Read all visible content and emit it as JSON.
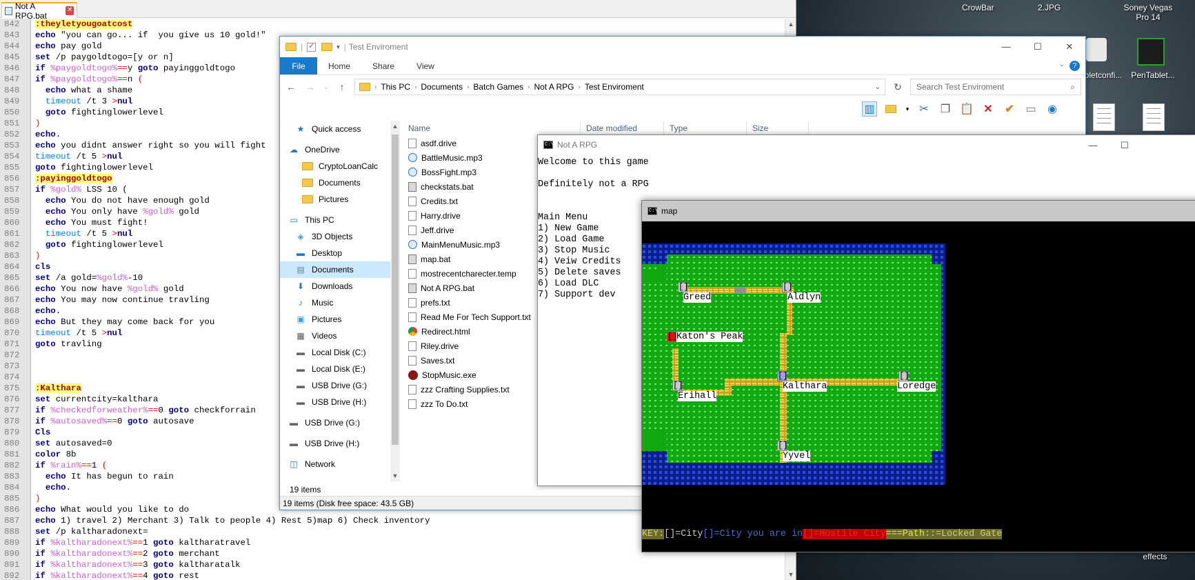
{
  "desktop": {
    "labels": [
      "CrowBar",
      "2.JPG",
      "Soney Vegas Pro 14",
      "abletconfi...",
      "PenTablet...",
      "effects"
    ],
    "colors": {
      "wallpaper": "#2a3640"
    }
  },
  "editor": {
    "tab_title": "Not A RPG.bat",
    "line_numbers": [
      "842",
      "843",
      "844",
      "845",
      "846",
      "847",
      "848",
      "849",
      "850",
      "851",
      "852",
      "853",
      "854",
      "855",
      "856",
      "857",
      "858",
      "859",
      "860",
      "861",
      "862",
      "863",
      "864",
      "865",
      "866",
      "867",
      "868",
      "869",
      "870",
      "871",
      "872",
      "873",
      "874",
      "875",
      "876",
      "877",
      "878",
      "879",
      "880",
      "881",
      "882",
      "883",
      "884",
      "885",
      "886",
      "887",
      "888",
      "889",
      "890",
      "891",
      "892"
    ],
    "lines": [
      [
        [
          "lbl",
          ":theyletyougoatcost"
        ]
      ],
      [
        [
          "kw",
          "echo"
        ],
        [
          "",
          " \"you can go... if  you give us 10 gold!\""
        ]
      ],
      [
        [
          "kw",
          "echo"
        ],
        [
          "",
          " pay gold"
        ]
      ],
      [
        [
          "kw",
          "set"
        ],
        [
          "",
          " /p paygoldtogo=[y or n]"
        ]
      ],
      [
        [
          "kw",
          "if"
        ],
        [
          "",
          " "
        ],
        [
          "var",
          "%paygoldtogo%"
        ],
        [
          "op",
          "=="
        ],
        [
          "",
          "y "
        ],
        [
          "kw",
          "goto"
        ],
        [
          "",
          " payinggoldtogo"
        ]
      ],
      [
        [
          "kw",
          "if"
        ],
        [
          "",
          " "
        ],
        [
          "var",
          "%paygoldtogo%"
        ],
        [
          "op",
          "=="
        ],
        [
          "",
          "n "
        ],
        [
          "op",
          "("
        ]
      ],
      [
        [
          "",
          "  "
        ],
        [
          "kw",
          "echo"
        ],
        [
          "",
          " what a shame"
        ]
      ],
      [
        [
          "",
          "  "
        ],
        [
          "tcmd",
          "timeout"
        ],
        [
          "",
          " /t 3 "
        ],
        [
          "op",
          ">"
        ],
        [
          "kw",
          "nul"
        ]
      ],
      [
        [
          "",
          "  "
        ],
        [
          "kw",
          "goto"
        ],
        [
          "",
          " fightinglowerlevel"
        ]
      ],
      [
        [
          "op",
          ")"
        ]
      ],
      [
        [
          "kw",
          "echo"
        ],
        [
          "",
          "."
        ]
      ],
      [
        [
          "kw",
          "echo"
        ],
        [
          "",
          " you didnt answer right so you will fight"
        ]
      ],
      [
        [
          "tcmd",
          "timeout"
        ],
        [
          "",
          " /t 5 "
        ],
        [
          "op",
          ">"
        ],
        [
          "kw",
          "nul"
        ]
      ],
      [
        [
          "kw",
          "goto"
        ],
        [
          "",
          " fightinglowerlevel"
        ]
      ],
      [
        [
          "lbl",
          ":payinggoldtogo"
        ]
      ],
      [
        [
          "kw",
          "if"
        ],
        [
          "",
          " "
        ],
        [
          "var",
          "%gold%"
        ],
        [
          "",
          " LSS 10 ("
        ]
      ],
      [
        [
          "",
          "  "
        ],
        [
          "kw",
          "echo"
        ],
        [
          "",
          " You do not have enough gold"
        ]
      ],
      [
        [
          "",
          "  "
        ],
        [
          "kw",
          "echo"
        ],
        [
          "",
          " You only have "
        ],
        [
          "var",
          "%gold%"
        ],
        [
          "",
          " gold"
        ]
      ],
      [
        [
          "",
          "  "
        ],
        [
          "kw",
          "echo"
        ],
        [
          "",
          " You must fight!"
        ]
      ],
      [
        [
          "",
          "  "
        ],
        [
          "tcmd",
          "timeout"
        ],
        [
          "",
          " /t 5 "
        ],
        [
          "op",
          ">"
        ],
        [
          "kw",
          "nul"
        ]
      ],
      [
        [
          "",
          "  "
        ],
        [
          "kw",
          "goto"
        ],
        [
          "",
          " fightinglowerlevel"
        ]
      ],
      [
        [
          "op",
          ")"
        ]
      ],
      [
        [
          "kw",
          "cls"
        ]
      ],
      [
        [
          "kw",
          "set"
        ],
        [
          "",
          " /a gold="
        ],
        [
          "var",
          "%gold%"
        ],
        [
          "",
          "-10"
        ]
      ],
      [
        [
          "kw",
          "echo"
        ],
        [
          "",
          " You now have "
        ],
        [
          "var",
          "%gold%"
        ],
        [
          "",
          " gold"
        ]
      ],
      [
        [
          "kw",
          "echo"
        ],
        [
          "",
          " You may now continue travling"
        ]
      ],
      [
        [
          "kw",
          "echo"
        ],
        [
          "",
          "."
        ]
      ],
      [
        [
          "kw",
          "echo"
        ],
        [
          "",
          " But they may come back for you"
        ]
      ],
      [
        [
          "tcmd",
          "timeout"
        ],
        [
          "",
          " /t 5 "
        ],
        [
          "op",
          ">"
        ],
        [
          "kw",
          "nul"
        ]
      ],
      [
        [
          "kw",
          "goto"
        ],
        [
          "",
          " travling"
        ]
      ],
      [],
      [],
      [],
      [
        [
          "lbl",
          ":Kalthara"
        ]
      ],
      [
        [
          "kw",
          "set"
        ],
        [
          "",
          " currentcity=kalthara"
        ]
      ],
      [
        [
          "kw",
          "if"
        ],
        [
          "",
          " "
        ],
        [
          "var",
          "%checkedforweather%"
        ],
        [
          "op",
          "=="
        ],
        [
          "",
          "0 "
        ],
        [
          "kw",
          "goto"
        ],
        [
          "",
          " checkforrain"
        ]
      ],
      [
        [
          "kw",
          "if"
        ],
        [
          "",
          " "
        ],
        [
          "var",
          "%autosaved%"
        ],
        [
          "op",
          "=="
        ],
        [
          "",
          "0 "
        ],
        [
          "kw",
          "goto"
        ],
        [
          "",
          " autosave"
        ]
      ],
      [
        [
          "kw",
          "Cls"
        ]
      ],
      [
        [
          "kw",
          "set"
        ],
        [
          "",
          " autosaved=0"
        ]
      ],
      [
        [
          "kw",
          "color"
        ],
        [
          "",
          " 8b"
        ]
      ],
      [
        [
          "kw",
          "if"
        ],
        [
          "",
          " "
        ],
        [
          "var",
          "%rain%"
        ],
        [
          "op",
          "=="
        ],
        [
          "",
          "1 "
        ],
        [
          "op",
          "("
        ]
      ],
      [
        [
          "",
          "  "
        ],
        [
          "kw",
          "echo"
        ],
        [
          "",
          " It has begun to rain"
        ]
      ],
      [
        [
          "",
          "  "
        ],
        [
          "kw",
          "echo"
        ],
        [
          "",
          "."
        ]
      ],
      [
        [
          "op",
          ")"
        ]
      ],
      [
        [
          "kw",
          "echo"
        ],
        [
          "",
          " What would you like to do"
        ]
      ],
      [
        [
          "kw",
          "echo"
        ],
        [
          "",
          " 1) travel 2) Merchant 3) Talk to people 4) Rest 5)map 6) Check inventory"
        ]
      ],
      [
        [
          "kw",
          "set"
        ],
        [
          "",
          " /p kaltharadonext="
        ]
      ],
      [
        [
          "kw",
          "if"
        ],
        [
          "",
          " "
        ],
        [
          "var",
          "%kaltharadonext%"
        ],
        [
          "op",
          "=="
        ],
        [
          "",
          "1 "
        ],
        [
          "kw",
          "goto"
        ],
        [
          "",
          " kaltharatravel"
        ]
      ],
      [
        [
          "kw",
          "if"
        ],
        [
          "",
          " "
        ],
        [
          "var",
          "%kaltharadonext%"
        ],
        [
          "op",
          "=="
        ],
        [
          "",
          "2 "
        ],
        [
          "kw",
          "goto"
        ],
        [
          "",
          " merchant"
        ]
      ],
      [
        [
          "kw",
          "if"
        ],
        [
          "",
          " "
        ],
        [
          "var",
          "%kaltharadonext%"
        ],
        [
          "op",
          "=="
        ],
        [
          "",
          "3 "
        ],
        [
          "kw",
          "goto"
        ],
        [
          "",
          " kaltharatalk"
        ]
      ],
      [
        [
          "kw",
          "if"
        ],
        [
          "",
          " "
        ],
        [
          "var",
          "%kaltharadonext%"
        ],
        [
          "op",
          "=="
        ],
        [
          "",
          "4 "
        ],
        [
          "kw",
          "goto"
        ],
        [
          "",
          " rest"
        ]
      ]
    ]
  },
  "explorer": {
    "title": "Test Enviroment",
    "ribbon_tabs": [
      "File",
      "Home",
      "Share",
      "View"
    ],
    "breadcrumb": [
      "This PC",
      "Documents",
      "Batch Games",
      "Not A RPG",
      "Test Enviroment"
    ],
    "search_placeholder": "Search Test Enviroment",
    "nav_items": [
      {
        "label": "Quick access",
        "icon": "star-icon",
        "indent": 1
      },
      {
        "label": "OneDrive",
        "icon": "cloud-icon",
        "indent": 0
      },
      {
        "label": "CryptoLoanCalc",
        "icon": "folder-icon",
        "indent": 2
      },
      {
        "label": "Documents",
        "icon": "folder-icon",
        "indent": 2
      },
      {
        "label": "Pictures",
        "icon": "folder-icon",
        "indent": 2
      },
      {
        "label": "This PC",
        "icon": "computer-icon",
        "indent": 0
      },
      {
        "label": "3D Objects",
        "icon": "cube-icon",
        "indent": 1
      },
      {
        "label": "Desktop",
        "icon": "desktop-icon",
        "indent": 1
      },
      {
        "label": "Documents",
        "icon": "documents-icon",
        "indent": 1,
        "selected": true
      },
      {
        "label": "Downloads",
        "icon": "download-icon",
        "indent": 1
      },
      {
        "label": "Music",
        "icon": "music-icon",
        "indent": 1
      },
      {
        "label": "Pictures",
        "icon": "pictures-icon",
        "indent": 1
      },
      {
        "label": "Videos",
        "icon": "videos-icon",
        "indent": 1
      },
      {
        "label": "Local Disk (C:)",
        "icon": "drive-icon",
        "indent": 1
      },
      {
        "label": "Local Disk (E:)",
        "icon": "drive-icon",
        "indent": 1
      },
      {
        "label": "USB Drive (G:)",
        "icon": "drive-icon",
        "indent": 1
      },
      {
        "label": "USB Drive (H:)",
        "icon": "drive-icon",
        "indent": 1
      },
      {
        "label": "USB Drive (G:)",
        "icon": "drive-icon",
        "indent": 0
      },
      {
        "label": "USB Drive (H:)",
        "icon": "drive-icon",
        "indent": 0
      },
      {
        "label": "Network",
        "icon": "network-icon",
        "indent": 0
      }
    ],
    "columns": [
      "Name",
      "Date modified",
      "Type",
      "Size"
    ],
    "files": [
      {
        "name": "asdf.drive",
        "kind": "file"
      },
      {
        "name": "BattleMusic.mp3",
        "kind": "audio"
      },
      {
        "name": "BossFight.mp3",
        "kind": "audio"
      },
      {
        "name": "checkstats.bat",
        "kind": "bat"
      },
      {
        "name": "Credits.txt",
        "kind": "file"
      },
      {
        "name": "Harry.drive",
        "kind": "file"
      },
      {
        "name": "Jeff.drive",
        "kind": "file"
      },
      {
        "name": "MainMenuMusic.mp3",
        "kind": "audio"
      },
      {
        "name": "map.bat",
        "kind": "bat"
      },
      {
        "name": "mostrecentcharecter.temp",
        "kind": "file"
      },
      {
        "name": "Not A RPG.bat",
        "kind": "bat"
      },
      {
        "name": "prefs.txt",
        "kind": "file"
      },
      {
        "name": "Read Me For Tech Support.txt",
        "kind": "file"
      },
      {
        "name": "Redirect.html",
        "kind": "chrome"
      },
      {
        "name": "Riley.drive",
        "kind": "file"
      },
      {
        "name": "Saves.txt",
        "kind": "file"
      },
      {
        "name": "StopMusic.exe",
        "kind": "exe"
      },
      {
        "name": "zzz Crafting Supplies.txt",
        "kind": "file"
      },
      {
        "name": "zzz To Do.txt",
        "kind": "file"
      }
    ],
    "items_count": "19 items",
    "status_bar": "19 items (Disk free space: 43.5 GB)"
  },
  "console": {
    "title": "Not A RPG",
    "text": "Welcome to this game\n\nDefinitely not a RPG\n\n\nMain Menu\n1) New Game\n2) Load Game\n3) Stop Music\n4) Veiw Credits\n5) Delete saves\n6) Load DLC\n7) Support dev"
  },
  "map": {
    "title": "map",
    "cities": [
      {
        "name": "Greed",
        "type": "city"
      },
      {
        "name": "Aldlyn",
        "type": "city"
      },
      {
        "name": "Katon's Peak",
        "type": "hostile"
      },
      {
        "name": "Erihall",
        "type": "city"
      },
      {
        "name": "Kalthara",
        "type": "current"
      },
      {
        "name": "Loredge",
        "type": "city"
      },
      {
        "name": "Yyvel",
        "type": "city"
      }
    ],
    "key": [
      {
        "text": "KEY:",
        "fg": "#cfcf7a",
        "bg": "#6b6b2a"
      },
      {
        "text": "[]",
        "fg": "#c8c8c8",
        "bg": "#000000"
      },
      {
        "text": "=City",
        "fg": "#c8c8c8",
        "bg": "#000000"
      },
      {
        "text": "[]",
        "fg": "#4a6ad6",
        "bg": "#000000"
      },
      {
        "text": "=City you are in",
        "fg": "#4a6ad6",
        "bg": "#000000"
      },
      {
        "text": "[]",
        "fg": "#ff2020",
        "bg": "#c00000"
      },
      {
        "text": "=Hostile City",
        "fg": "#ff2020",
        "bg": "#c00000"
      },
      {
        "text": "==",
        "fg": "#e8e84a",
        "bg": "#6b6b2a"
      },
      {
        "text": "=Path",
        "fg": "#e8e84a",
        "bg": "#6b6b2a"
      },
      {
        "text": "::",
        "fg": "#cfcf7a",
        "bg": "#6b6b2a"
      },
      {
        "text": "=Locked Gate",
        "fg": "#cfcf7a",
        "bg": "#6b6b2a"
      }
    ],
    "colors": {
      "water": "#0a1e8c",
      "water_glyph": "#2c4de0",
      "grass": "#11a811",
      "grass_glyph": "#7adf7a",
      "path": "#c9a516",
      "path_glyph": "#a58a10",
      "gate": "#8f8f8f"
    }
  }
}
